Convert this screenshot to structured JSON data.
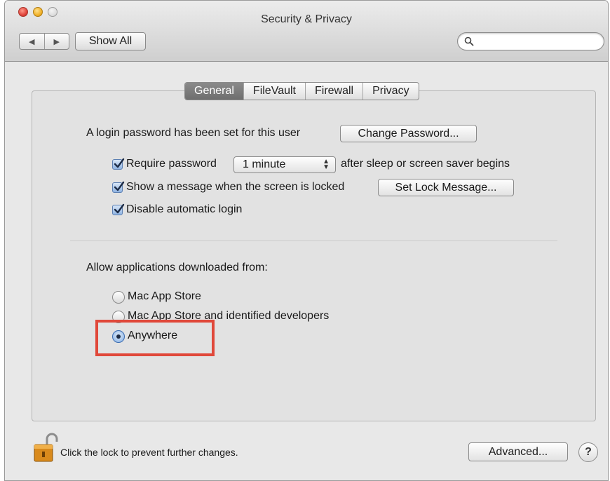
{
  "window": {
    "title": "Security & Privacy"
  },
  "toolbar": {
    "back_glyph": "◀",
    "forward_glyph": "▶",
    "show_all_label": "Show All",
    "search_placeholder": ""
  },
  "tabs": [
    {
      "label": "General",
      "active": true
    },
    {
      "label": "FileVault",
      "active": false
    },
    {
      "label": "Firewall",
      "active": false
    },
    {
      "label": "Privacy",
      "active": false
    }
  ],
  "general": {
    "login_password_text": "A login password has been set for this user",
    "change_password_label": "Change Password...",
    "require_password": {
      "checked": true,
      "label": "Require password",
      "popup_value": "1 minute",
      "suffix": "after sleep or screen saver begins"
    },
    "show_message": {
      "checked": true,
      "label": "Show a message when the screen is locked",
      "button_label": "Set Lock Message..."
    },
    "disable_auto_login": {
      "checked": true,
      "label": "Disable automatic login"
    },
    "allow_apps_heading": "Allow applications downloaded from:",
    "allow_apps_options": [
      {
        "label": "Mac App Store",
        "selected": false
      },
      {
        "label": "Mac App Store and identified developers",
        "selected": false
      },
      {
        "label": "Anywhere",
        "selected": true
      }
    ]
  },
  "footer": {
    "lock_text": "Click the lock to prevent further changes.",
    "advanced_label": "Advanced...",
    "help_label": "?"
  },
  "colors": {
    "highlight_border": "#e0483a",
    "checkbox_accent": "#8fb3e2"
  }
}
